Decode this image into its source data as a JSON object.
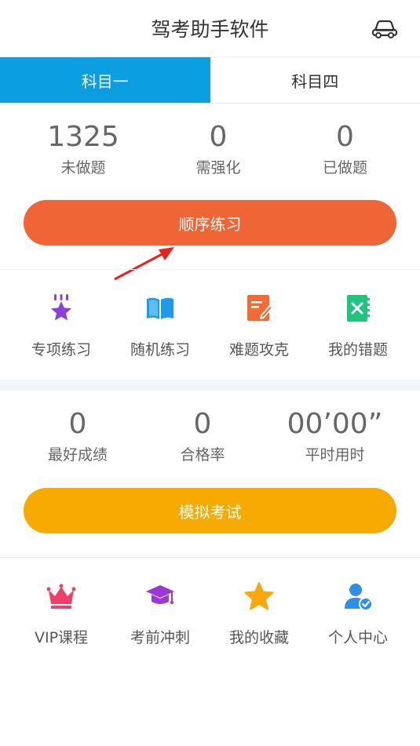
{
  "header": {
    "title": "驾考助手软件",
    "right_icon": "car-icon"
  },
  "tabs": [
    {
      "label": "科目一",
      "active": true
    },
    {
      "label": "科目四",
      "active": false
    }
  ],
  "practice_stats": [
    {
      "value": "1325",
      "label": "未做题"
    },
    {
      "value": "0",
      "label": "需强化"
    },
    {
      "value": "0",
      "label": "已做题"
    }
  ],
  "sequential_button": {
    "label": "顺序练习",
    "color": "#f06535"
  },
  "practice_grid": [
    {
      "label": "专项练习",
      "icon": "star-badge-icon",
      "color": "#8a3fd6"
    },
    {
      "label": "随机练习",
      "icon": "open-book-icon",
      "color": "#1e9be8"
    },
    {
      "label": "难题攻克",
      "icon": "edit-note-icon",
      "color": "#f36b34"
    },
    {
      "label": "我的错题",
      "icon": "error-notebook-icon",
      "color": "#1fc47f"
    }
  ],
  "exam_stats": [
    {
      "value": "0",
      "label": "最好成绩"
    },
    {
      "value": "0",
      "label": "合格率"
    },
    {
      "value": "00’00”",
      "label": "平时用时"
    }
  ],
  "exam_button": {
    "label": "模拟考试",
    "color": "#f7ab00"
  },
  "bottom_grid": [
    {
      "label": "VIP课程",
      "icon": "crown-icon",
      "color": "#f0406a"
    },
    {
      "label": "考前冲刺",
      "icon": "graduation-cap-icon",
      "color": "#9c36d8"
    },
    {
      "label": "我的收藏",
      "icon": "star-icon",
      "color": "#f8a80c"
    },
    {
      "label": "个人中心",
      "icon": "user-verified-icon",
      "color": "#2f8fe6"
    }
  ]
}
